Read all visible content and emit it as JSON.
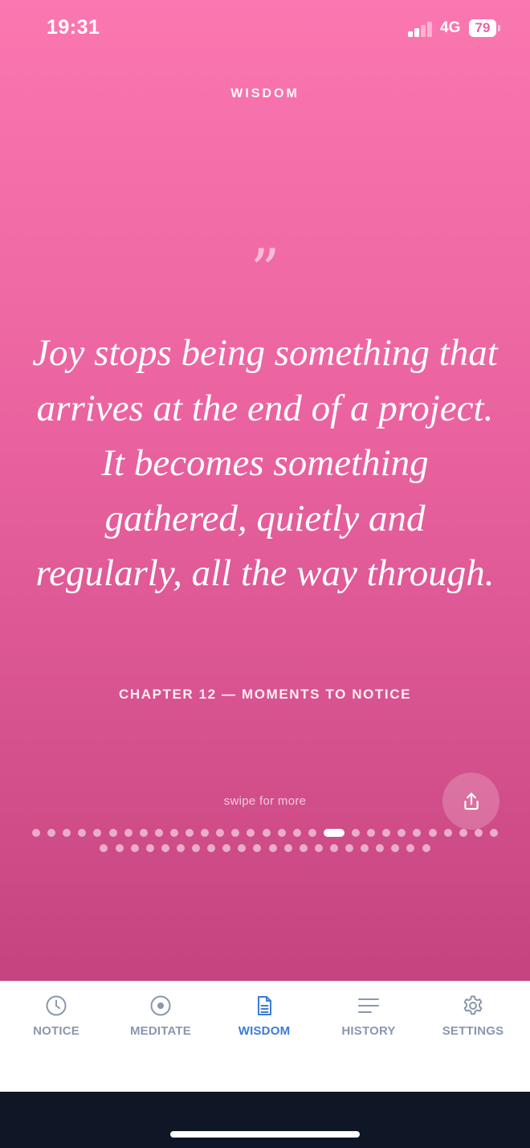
{
  "status_bar": {
    "time": "19:31",
    "network": "4G",
    "battery": "79"
  },
  "header": {
    "title": "WISDOM"
  },
  "quote": {
    "mark": "”",
    "text": "Joy stops being something that arrives at the end of a project. It becomes something gathered, quietly and regularly, all the way through.",
    "source": "CHAPTER 12 — MOMENTS TO NOTICE"
  },
  "pager": {
    "hint": "swipe for more",
    "row1_count": 30,
    "row2_count": 22,
    "active_index": 19
  },
  "tabs": [
    {
      "label": "NOTICE",
      "icon": "clock-icon",
      "active": false
    },
    {
      "label": "MEDITATE",
      "icon": "target-icon",
      "active": false
    },
    {
      "label": "WISDOM",
      "icon": "document-icon",
      "active": true
    },
    {
      "label": "HISTORY",
      "icon": "lines-icon",
      "active": false
    },
    {
      "label": "SETTINGS",
      "icon": "gear-icon",
      "active": false
    }
  ],
  "colors": {
    "accent": "#3c7bd6",
    "inactive": "#8a97ae",
    "gradient_top": "#fb77b0",
    "gradient_bottom": "#c5447f"
  }
}
